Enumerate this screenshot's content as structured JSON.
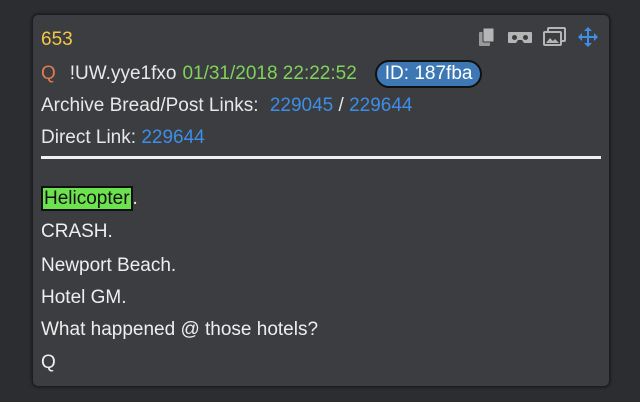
{
  "post": {
    "number": "653",
    "q_letter": "Q",
    "tripcode": "!UW.yye1fxo",
    "datetime": "01/31/2018 22:22:52",
    "id_badge": "ID: 187fba",
    "archive_label": "Archive Bread/Post Links:",
    "archive_link_1": "229045",
    "archive_sep": "/",
    "archive_link_2": "229644",
    "direct_label": "Direct Link:",
    "direct_link": "229644",
    "highlight_word": "Helicopter",
    "highlight_suffix": ".",
    "lines": [
      "CRASH.",
      "Newport Beach.",
      "Hotel GM.",
      "What happened @ those hotels?",
      "Q"
    ]
  },
  "toolbar": {
    "icons": [
      "copy-icon",
      "vr-glasses-icon",
      "images-icon",
      "move-icon"
    ]
  },
  "colors": {
    "post_bg": "#3c3d40",
    "number": "#f3c645",
    "q_letter": "#e07a52",
    "date": "#7fd25a",
    "link": "#3d8ee6",
    "id_badge": "#3d78b5",
    "highlight": "#6de24f"
  }
}
